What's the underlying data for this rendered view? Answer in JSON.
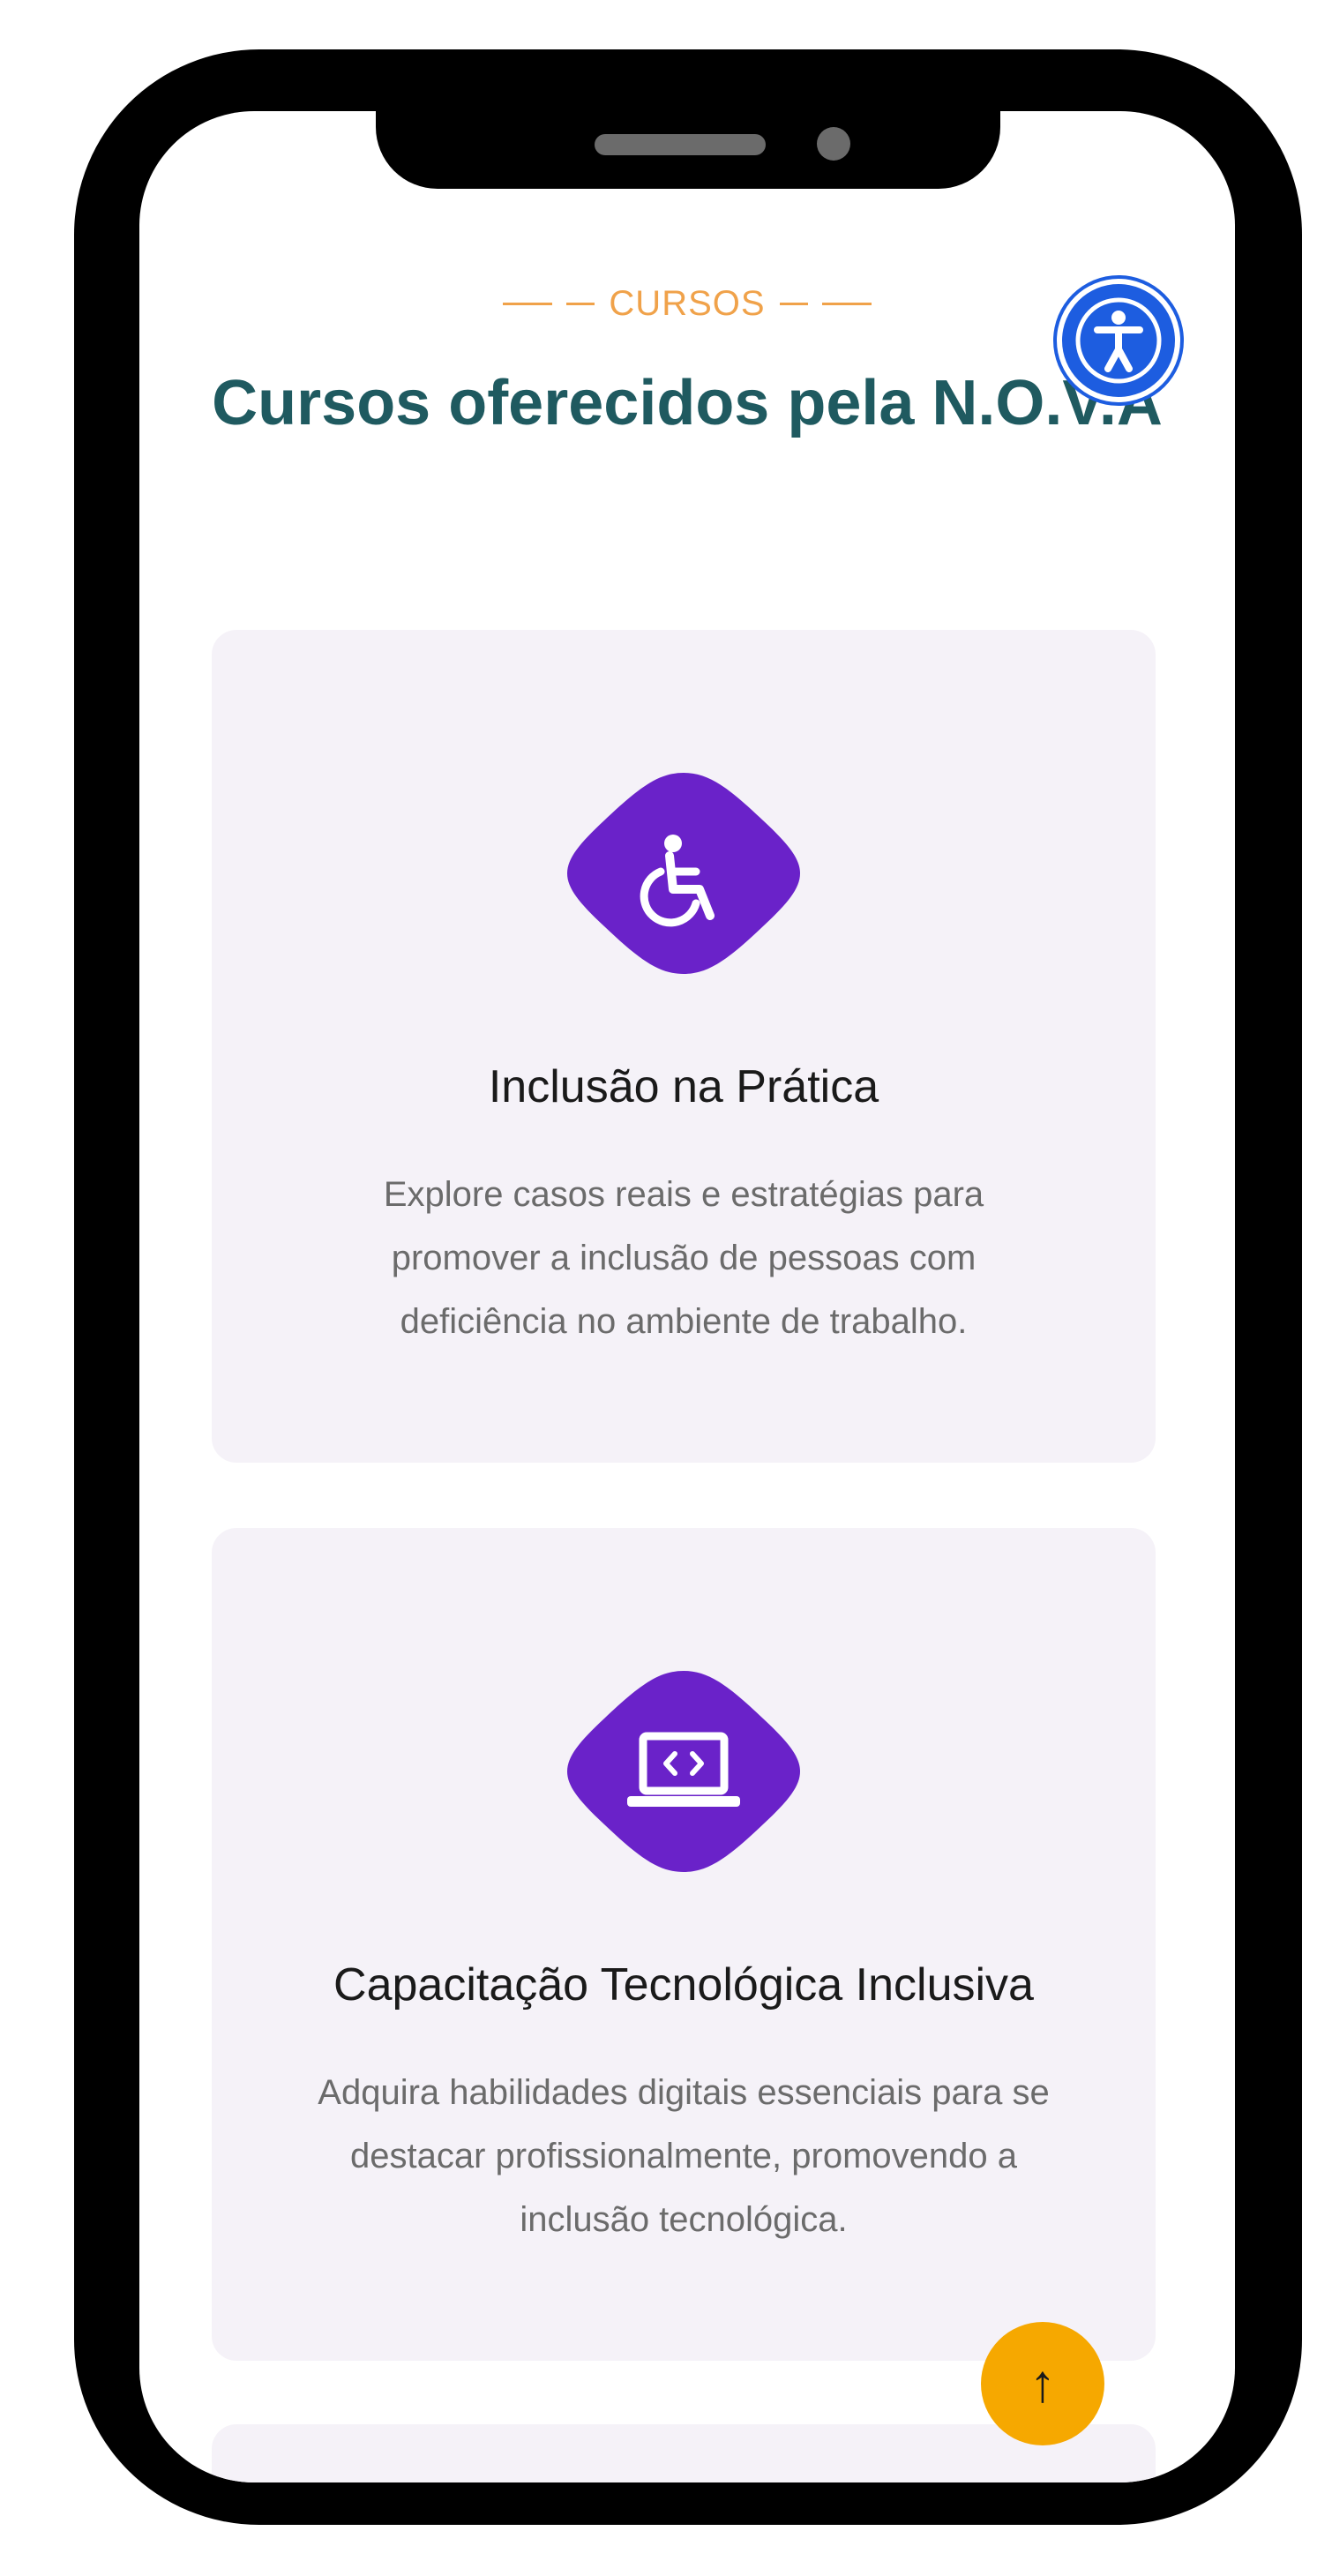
{
  "section": {
    "eyebrow": "CURSOS",
    "title": "Cursos oferecidos pela N.O.V.A"
  },
  "cards": [
    {
      "icon": "wheelchair-icon",
      "title": "Inclusão na Prática",
      "text": "Explore casos reais e estratégias para promover a inclusão de pessoas com deficiência no ambiente de trabalho."
    },
    {
      "icon": "laptop-code-icon",
      "title": "Capacitação Tecnológica Inclusiva",
      "text": "Adquira habilidades digitais essenciais para se destacar profissionalmente, promovendo a inclusão tecnológica."
    }
  ],
  "accessibility_button": {
    "icon": "accessibility-icon"
  },
  "back_to_top": {
    "glyph": "↑"
  },
  "colors": {
    "accent_orange": "#f0a24a",
    "title_teal": "#1f5a60",
    "icon_purple": "#6a22c9",
    "card_bg": "#f5f2f8",
    "access_blue": "#1d5de0",
    "top_button": "#f6a800"
  }
}
